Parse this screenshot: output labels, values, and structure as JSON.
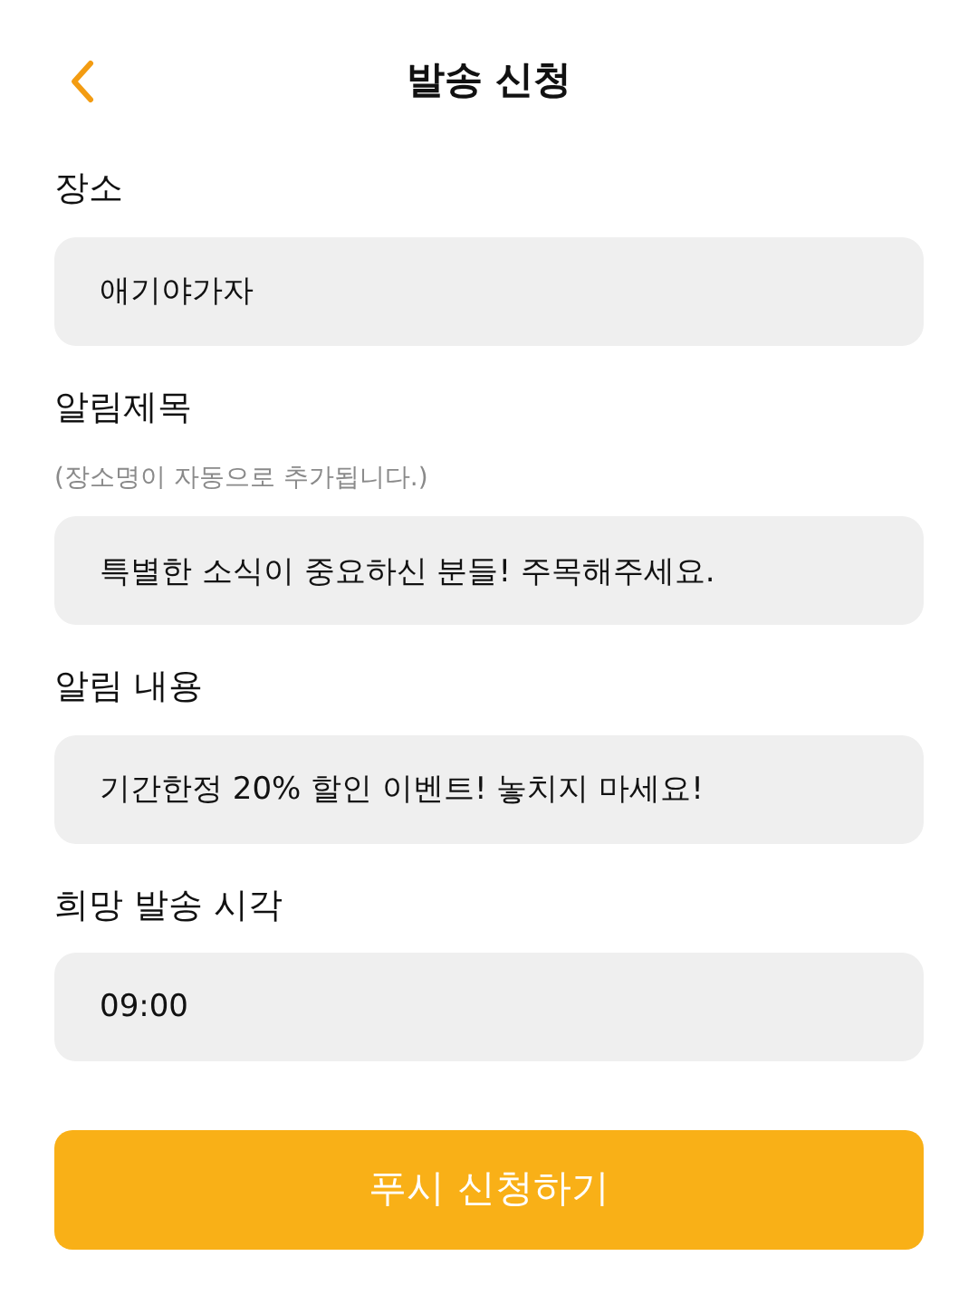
{
  "header": {
    "title": "발송 신청"
  },
  "fields": [
    {
      "label": "장소",
      "value": "애기야가자"
    },
    {
      "label": "알림제목",
      "hint": "(장소명이 자동으로 추가됩니다.)",
      "value": "특별한 소식이 중요하신 분들! 주목해주세요."
    },
    {
      "label": "알림 내용",
      "value": "기간한정 20% 할인 이벤트! 놓치지 마세요!"
    },
    {
      "label": "희망 발송 시각",
      "value": "09:00"
    }
  ],
  "submit_button": "푸시 신청하기"
}
